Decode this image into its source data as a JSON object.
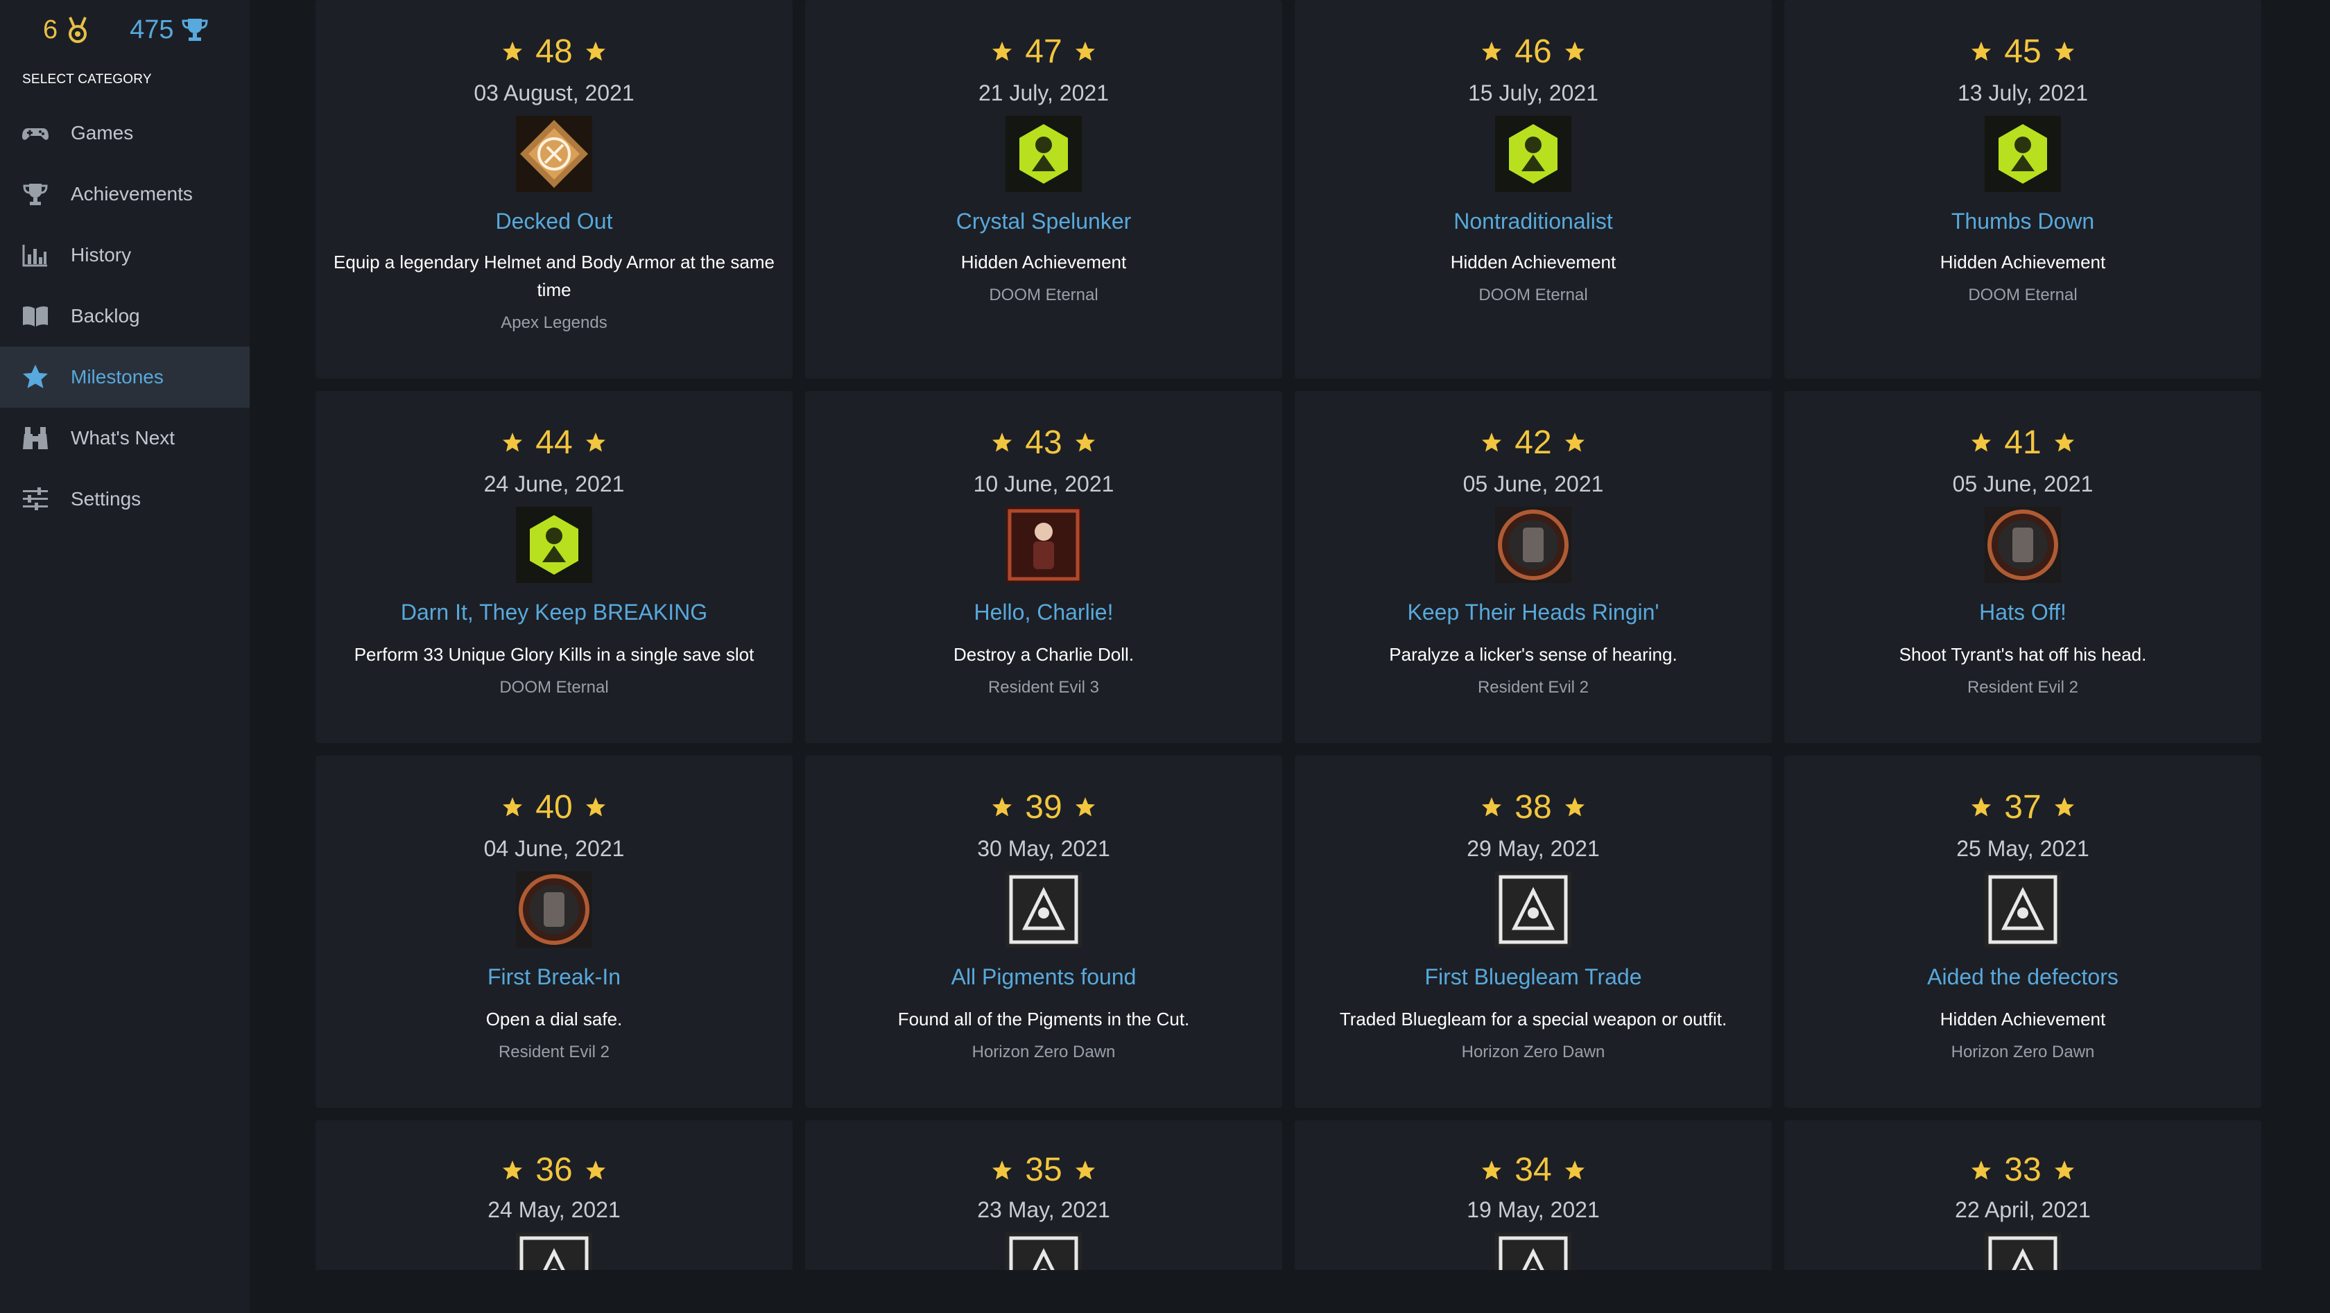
{
  "stats": {
    "medals": "6",
    "trophies": "475"
  },
  "sidebar": {
    "category_title": "SELECT CATEGORY",
    "items": [
      {
        "label": "Games",
        "icon": "gamepad-icon",
        "active": false
      },
      {
        "label": "Achievements",
        "icon": "trophy-icon",
        "active": false
      },
      {
        "label": "History",
        "icon": "bar-chart-icon",
        "active": false
      },
      {
        "label": "Backlog",
        "icon": "book-icon",
        "active": false
      },
      {
        "label": "Milestones",
        "icon": "star-icon",
        "active": true
      },
      {
        "label": "What's Next",
        "icon": "binoculars-icon",
        "active": false
      },
      {
        "label": "Settings",
        "icon": "sliders-icon",
        "active": false
      }
    ]
  },
  "colors": {
    "accent": "#58a9dd",
    "gold": "#f3c63f",
    "background": "#15181d",
    "card": "#1c1f25"
  },
  "milestones": [
    {
      "number": "48",
      "date": "03 August, 2021",
      "name": "Decked Out",
      "description": "Equip a legendary Helmet and Body Armor at the same time",
      "game": "Apex Legends",
      "badge": "apex-badge-icon"
    },
    {
      "number": "47",
      "date": "21 July, 2021",
      "name": "Crystal Spelunker",
      "description": "Hidden Achievement",
      "game": "DOOM Eternal",
      "badge": "doom-badge-icon"
    },
    {
      "number": "46",
      "date": "15 July, 2021",
      "name": "Nontraditionalist",
      "description": "Hidden Achievement",
      "game": "DOOM Eternal",
      "badge": "doom-badge-icon"
    },
    {
      "number": "45",
      "date": "13 July, 2021",
      "name": "Thumbs Down",
      "description": "Hidden Achievement",
      "game": "DOOM Eternal",
      "badge": "doom-badge-icon"
    },
    {
      "number": "44",
      "date": "24 June, 2021",
      "name": "Darn It, They Keep BREAKING",
      "description": "Perform 33 Unique Glory Kills in a single save slot",
      "game": "DOOM Eternal",
      "badge": "doom-badge-icon"
    },
    {
      "number": "43",
      "date": "10 June, 2021",
      "name": "Hello, Charlie!",
      "description": "Destroy a Charlie Doll.",
      "game": "Resident Evil 3",
      "badge": "re3-badge-icon"
    },
    {
      "number": "42",
      "date": "05 June, 2021",
      "name": "Keep Their Heads Ringin'",
      "description": "Paralyze a licker's sense of hearing.",
      "game": "Resident Evil 2",
      "badge": "re2-badge-icon"
    },
    {
      "number": "41",
      "date": "05 June, 2021",
      "name": "Hats Off!",
      "description": "Shoot Tyrant's hat off his head.",
      "game": "Resident Evil 2",
      "badge": "re2-badge-icon"
    },
    {
      "number": "40",
      "date": "04 June, 2021",
      "name": "First Break-In",
      "description": "Open a dial safe.",
      "game": "Resident Evil 2",
      "badge": "re2-badge-icon"
    },
    {
      "number": "39",
      "date": "30 May, 2021",
      "name": "All Pigments found",
      "description": "Found all of the Pigments in the Cut.",
      "game": "Horizon Zero Dawn",
      "badge": "horizon-badge-icon"
    },
    {
      "number": "38",
      "date": "29 May, 2021",
      "name": "First Bluegleam Trade",
      "description": "Traded Bluegleam for a special weapon or outfit.",
      "game": "Horizon Zero Dawn",
      "badge": "horizon-badge-icon"
    },
    {
      "number": "37",
      "date": "25 May, 2021",
      "name": "Aided the defectors",
      "description": "Hidden Achievement",
      "game": "Horizon Zero Dawn",
      "badge": "horizon-badge-icon"
    },
    {
      "number": "36",
      "date": "24 May, 2021",
      "badge": "horizon-badge-icon"
    },
    {
      "number": "35",
      "date": "23 May, 2021",
      "badge": "horizon-badge-icon"
    },
    {
      "number": "34",
      "date": "19 May, 2021",
      "badge": "horizon-badge-icon"
    },
    {
      "number": "33",
      "date": "22 April, 2021",
      "badge": "horizon-badge-icon"
    }
  ]
}
